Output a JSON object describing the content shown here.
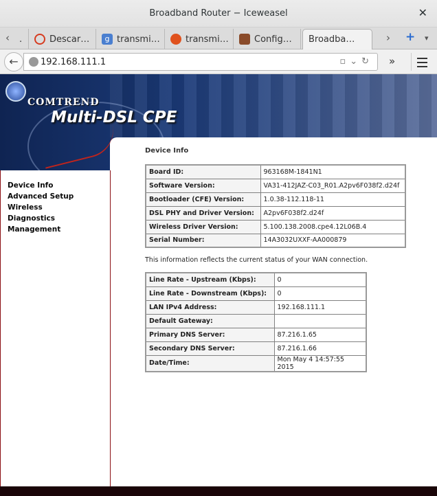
{
  "window": {
    "title": "Broadband Router − Iceweasel"
  },
  "tabs": [
    {
      "label": "Descar…",
      "icon": "opera-icon",
      "icon_color": "#d63b1f"
    },
    {
      "label": "transmi…",
      "icon": "google-icon",
      "icon_color": "#4a7fd0"
    },
    {
      "label": "transmi…",
      "icon": "duckduckgo-icon",
      "icon_color": "#e0521e"
    },
    {
      "label": "Config…",
      "icon": "gear-icon",
      "icon_color": "#8a4b2a"
    },
    {
      "label": "Broadba…",
      "icon": "",
      "icon_color": ""
    }
  ],
  "navbar": {
    "url": "192.168.111.1"
  },
  "banner": {
    "brand": "COMTREND",
    "product": "Multi-DSL CPE"
  },
  "sidebar": {
    "items": [
      {
        "label": "Device Info"
      },
      {
        "label": "Advanced Setup"
      },
      {
        "label": "Wireless"
      },
      {
        "label": "Diagnostics"
      },
      {
        "label": "Management"
      }
    ]
  },
  "main": {
    "heading": "Device Info",
    "device_table": [
      {
        "key": "Board ID:",
        "value": "963168M-1841N1"
      },
      {
        "key": "Software Version:",
        "value": "VA31-412JAZ-C03_R01.A2pv6F038f2.d24f"
      },
      {
        "key": "Bootloader (CFE) Version:",
        "value": "1.0.38-112.118-11"
      },
      {
        "key": "DSL PHY and Driver Version:",
        "value": "A2pv6F038f2.d24f"
      },
      {
        "key": "Wireless Driver Version:",
        "value": "5.100.138.2008.cpe4.12L06B.4"
      },
      {
        "key": "Serial Number:",
        "value": "14A3032UXXF-AA000879"
      }
    ],
    "wan_note": "This information reflects the current status of your WAN connection.",
    "wan_table": [
      {
        "key": "Line Rate - Upstream (Kbps):",
        "value": "0"
      },
      {
        "key": "Line Rate - Downstream (Kbps):",
        "value": "0"
      },
      {
        "key": "LAN IPv4 Address:",
        "value": "192.168.111.1"
      },
      {
        "key": "Default Gateway:",
        "value": ""
      },
      {
        "key": "Primary DNS Server:",
        "value": "87.216.1.65"
      },
      {
        "key": "Secondary DNS Server:",
        "value": "87.216.1.66"
      },
      {
        "key": "Date/Time:",
        "value": "Mon May 4 14:57:55 2015"
      }
    ]
  }
}
